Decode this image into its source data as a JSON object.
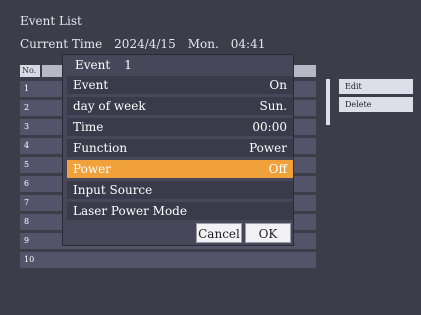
{
  "header": {
    "title": "Event List",
    "current_time_label": "Current Time",
    "date": "2024/4/15",
    "weekday": "Mon.",
    "time": "04:41"
  },
  "table": {
    "no_label": "No.",
    "rows": [
      "1",
      "2",
      "3",
      "4",
      "5",
      "6",
      "7",
      "8",
      "9",
      "10"
    ]
  },
  "actions": {
    "edit": "Edit",
    "delete": "Delete"
  },
  "dialog": {
    "title_label": "Event",
    "title_number": "1",
    "rows": [
      {
        "label": "Event",
        "value": "On"
      },
      {
        "label": "day of week",
        "value": "Sun."
      },
      {
        "label": "Time",
        "value": "00:00"
      },
      {
        "label": "Function",
        "value": "Power"
      },
      {
        "label": "Power",
        "value": "Off",
        "active": true
      },
      {
        "label": "Input Source",
        "value": ""
      },
      {
        "label": "Laser Power Mode",
        "value": ""
      }
    ],
    "cancel": "Cancel",
    "ok": "OK"
  },
  "colors": {
    "background": "#3d3d4a",
    "highlight": "#f0a13a",
    "row": "#53536a"
  }
}
